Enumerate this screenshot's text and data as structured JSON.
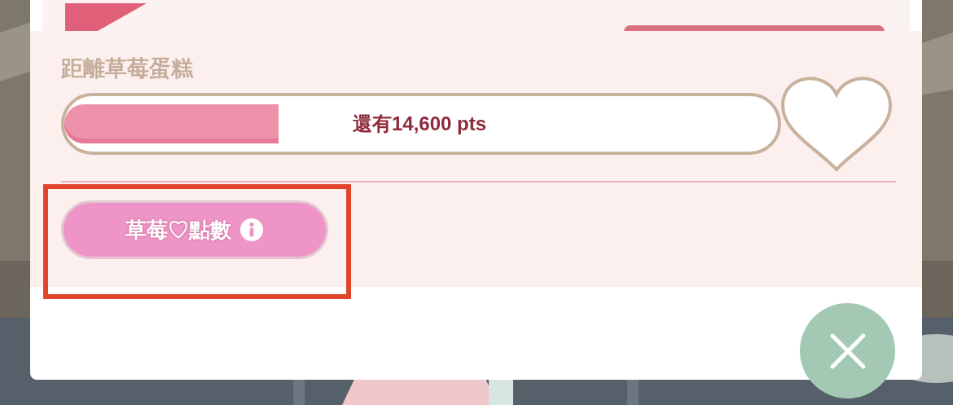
{
  "goal": {
    "label": "距離草莓蛋糕",
    "level": 0.3,
    "remaining": "還有14,600 pts"
  },
  "points_button": {
    "label": "草莓♡點數"
  },
  "highlight": true
}
